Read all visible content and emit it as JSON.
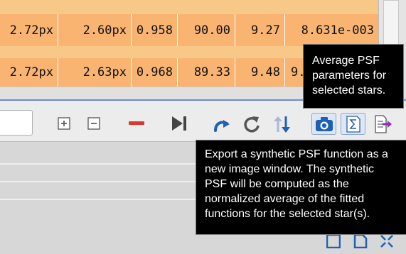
{
  "table": {
    "rows": [
      {
        "cells": [
          "2.72px",
          "2.60px",
          "0.958",
          "90.00",
          "9.27",
          "8.631e-003"
        ]
      },
      {
        "cells": [
          "2.72px",
          "2.63px",
          "0.968",
          "89.33",
          "9.48",
          "9."
        ]
      }
    ]
  },
  "toolbar": {
    "buttons": [
      {
        "name": "expand-all-button",
        "icon": "plus-box-icon"
      },
      {
        "name": "collapse-all-button",
        "icon": "minus-box-icon"
      },
      {
        "name": "delete-button",
        "icon": "red-minus-icon"
      },
      {
        "name": "go-to-end-button",
        "icon": "skip-end-icon"
      },
      {
        "name": "redo-button",
        "icon": "redo-arrow-icon"
      },
      {
        "name": "recalculate-button",
        "icon": "circular-refresh-icon"
      },
      {
        "name": "sort-button",
        "icon": "sort-arrows-icon"
      },
      {
        "name": "export-synthetic-psf-button",
        "icon": "camera-icon"
      },
      {
        "name": "average-psf-button",
        "icon": "sigma-icon"
      },
      {
        "name": "export-table-button",
        "icon": "document-export-icon"
      }
    ]
  },
  "tooltips": {
    "average": [
      "Average PSF",
      "parameters for",
      "selected stars."
    ],
    "export": [
      "Export a synthetic PSF function as a",
      "new image window. The synthetic",
      "PSF will be computed as the",
      "normalized average of the fitted",
      "functions for the selected star(s)."
    ]
  },
  "colors": {
    "row": "#f8c888",
    "row_stripe": "#f9b472",
    "accent_blue": "#1f5fb4",
    "delete_red": "#d93a2f",
    "tooltip_bg": "#000000"
  }
}
